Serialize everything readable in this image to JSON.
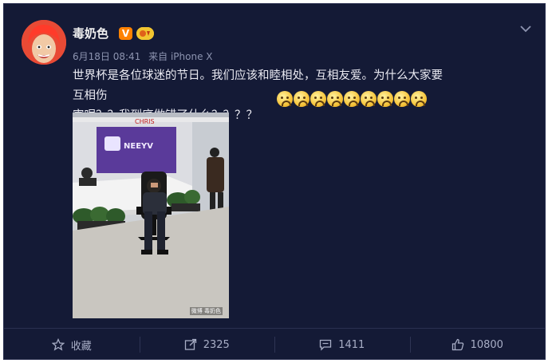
{
  "post": {
    "username": "毒奶色",
    "badge_v": "V",
    "badge_vip": "ঌ",
    "date": "6月18日 08:41",
    "source": "来自 iPhone X",
    "text_line1": "世界杯是各位球迷的节日。我们应该和睦相处，互相友爱。为什么大家要互相伤",
    "text_line2": "害呢？？我到底做错了什么？？？？",
    "emoji_count": 9,
    "emoji_name": "crying-face-emoji",
    "photo": {
      "sign_text": "NEEYV",
      "banner_text": "CHRIS",
      "watermark": "微博 毒奶色"
    }
  },
  "actions": {
    "favorite_label": "收藏",
    "repost_count": "2325",
    "comment_count": "1411",
    "like_count": "10800"
  },
  "colors": {
    "background": "#141a36",
    "text": "#eaeaf2",
    "meta": "#8d94b0",
    "accent_v": "#ff8200"
  }
}
